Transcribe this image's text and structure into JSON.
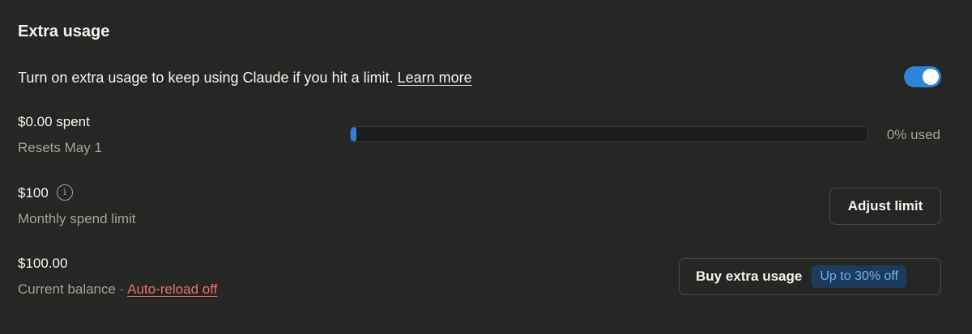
{
  "section": {
    "title": "Extra usage"
  },
  "description": {
    "text": "Turn on extra usage to keep using Claude if you hit a limit.",
    "learn_more_label": "Learn more"
  },
  "toggle": {
    "enabled": true,
    "color": "#2c84db"
  },
  "spent": {
    "amount": "$0.00 spent",
    "resets": "Resets May 1",
    "progress_percent": 0,
    "used_label": "0% used"
  },
  "limit": {
    "amount": "$100",
    "info_icon": "info-icon",
    "subtitle": "Monthly spend limit",
    "adjust_label": "Adjust limit"
  },
  "balance": {
    "amount": "$100.00",
    "subtitle": "Current balance ·",
    "auto_reload_label": "Auto-reload off",
    "buy_label": "Buy extra usage",
    "discount_label": "Up to 30% off"
  },
  "colors": {
    "background": "#262624",
    "accent": "#2c84db",
    "warning_link": "#e8706a",
    "badge_bg": "#1e3a5c",
    "badge_text": "#6fb0ee"
  }
}
